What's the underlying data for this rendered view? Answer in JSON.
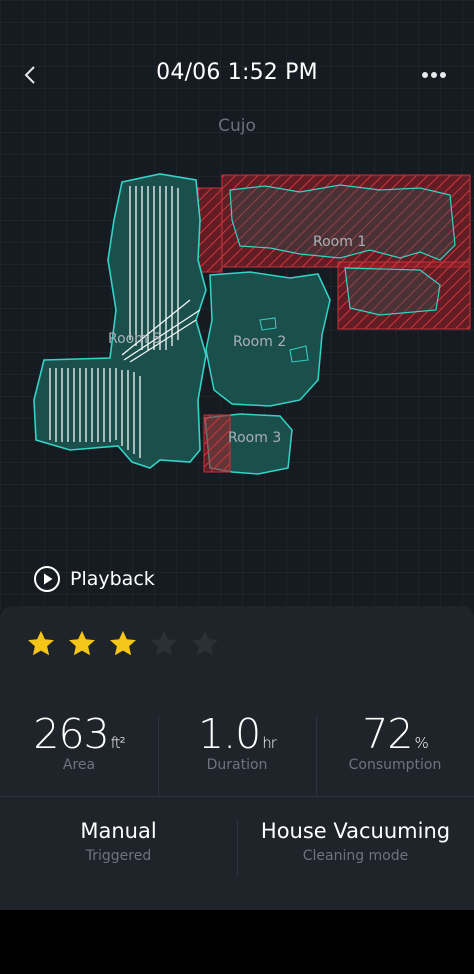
{
  "header": {
    "title": "04/06 1:52 PM",
    "back_icon": "chevron-left-icon",
    "more_icon": "more-dots-icon"
  },
  "robot_name": "Cujo",
  "map": {
    "rooms": [
      {
        "label": "Room 1",
        "status": "excluded"
      },
      {
        "label": "Room 2",
        "status": "cleaned"
      },
      {
        "label": "Room 3",
        "status": "cleaned"
      },
      {
        "label": "Room 5",
        "status": "cleaned"
      }
    ],
    "colors": {
      "wall": "#34d3c6",
      "floor": "#1d5a57",
      "no_go": "#b52a30",
      "path": "#ffffff"
    }
  },
  "playback": {
    "label": "Playback",
    "icon": "play-circle-icon"
  },
  "rating": {
    "stars": 3,
    "max": 5,
    "filled_color": "#f5c518",
    "empty_color": "#2b3036"
  },
  "stats": [
    {
      "value": "263",
      "unit": "ft²",
      "label": "Area"
    },
    {
      "value": "1.0",
      "unit": "hr",
      "label": "Duration"
    },
    {
      "value": "72",
      "unit": "%",
      "label": "Consumption"
    }
  ],
  "info": {
    "trigger": {
      "value": "Manual",
      "label": "Triggered"
    },
    "mode": {
      "value": "House Vacuuming",
      "label": "Cleaning mode"
    }
  }
}
